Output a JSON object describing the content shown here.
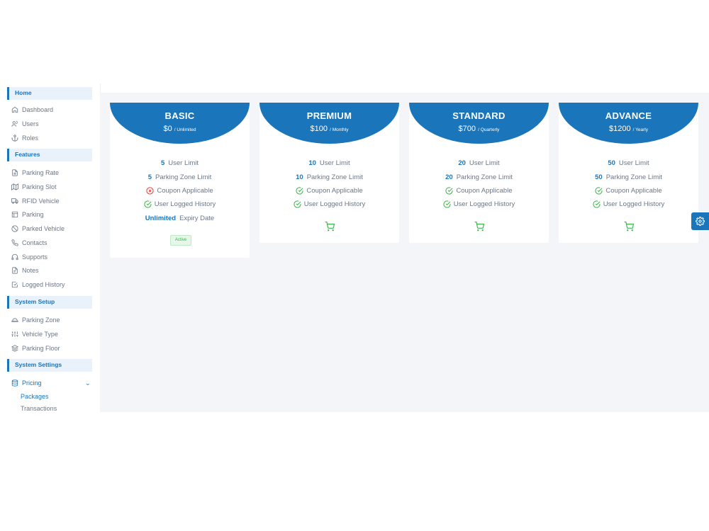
{
  "sidebar": {
    "home": "Home",
    "home_items": [
      "Dashboard",
      "Users",
      "Roles"
    ],
    "features": "Features",
    "features_items": [
      "Parking Rate",
      "Parking Slot",
      "RFID Vehicle",
      "Parking",
      "Parked Vehicle",
      "Contacts",
      "Supports",
      "Notes",
      "Logged History"
    ],
    "system_setup": "System Setup",
    "setup_items": [
      "Parking Zone",
      "Vehicle Type",
      "Parking Floor"
    ],
    "system_settings": "System Settings",
    "pricing": "Pricing",
    "pricing_sub": [
      "Packages",
      "Transactions"
    ]
  },
  "labels": {
    "user_limit": "User Limit",
    "zone_limit": "Parking Zone Limit",
    "coupon": "Coupon Applicable",
    "history": "User Logged History",
    "expiry": "Expiry Date"
  },
  "plans": [
    {
      "name": "BASIC",
      "price": "$0",
      "period": "/ Unlimited",
      "users": "5",
      "zones": "5",
      "coupon": false,
      "history": true,
      "expiry": "Unlimited",
      "status": "Active"
    },
    {
      "name": "PREMIUM",
      "price": "$100",
      "period": "/ Monthly",
      "users": "10",
      "zones": "10",
      "coupon": true,
      "history": true
    },
    {
      "name": "STANDARD",
      "price": "$700",
      "period": "/ Quarterly",
      "users": "20",
      "zones": "20",
      "coupon": true,
      "history": true
    },
    {
      "name": "ADVANCE",
      "price": "$1200",
      "period": "/ Yearly",
      "users": "50",
      "zones": "50",
      "coupon": true,
      "history": true
    }
  ],
  "colors": {
    "accent": "#1a75bb",
    "check": "#3bb54a",
    "cross": "#e53935"
  },
  "icons": [
    "home-icon",
    "users-icon",
    "anchor-icon",
    "file-icon",
    "map-icon",
    "truck-icon",
    "layout-icon",
    "slash-circle-icon",
    "phone-icon",
    "headphones-icon",
    "notes-icon",
    "check-square-icon",
    "layers-icon",
    "sliders-icon",
    "database-icon",
    "cart-icon",
    "gear-icon",
    "check-circle-icon",
    "x-circle-icon"
  ]
}
